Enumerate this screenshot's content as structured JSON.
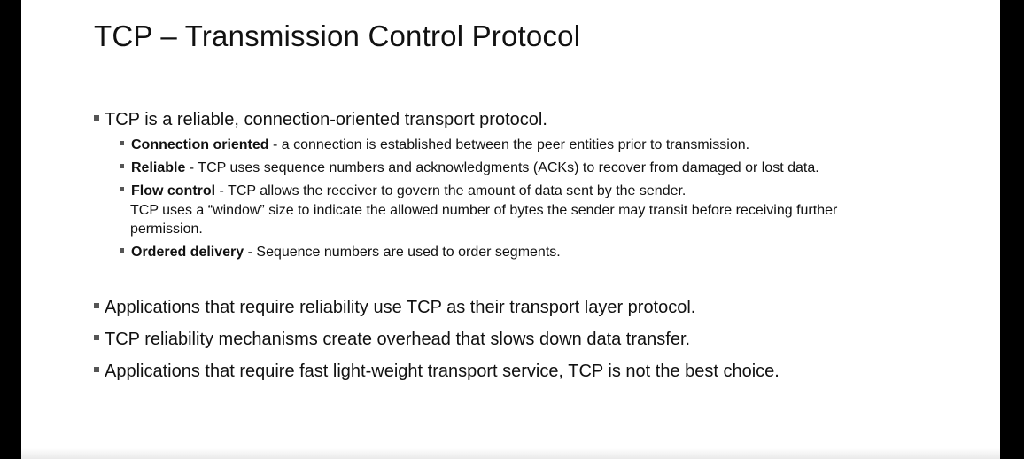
{
  "title": "TCP – Transmission Control Protocol",
  "main_bullet": "TCP is a reliable, connection-oriented transport protocol.",
  "sub_bullets": [
    {
      "term": "Connection oriented",
      "text": " - a connection is established between the peer entities prior to transmission."
    },
    {
      "term": "Reliable",
      "text": " - TCP uses sequence numbers and acknowledgments (ACKs) to recover from damaged or lost data."
    },
    {
      "term": "Flow control",
      "text": " - TCP allows the receiver to govern the amount of data sent by the sender.",
      "line2": "TCP uses a “window” size to indicate the allowed number of bytes the sender may transit before receiving further",
      "line3": "permission."
    },
    {
      "term": "Ordered delivery",
      "text": " - Sequence numbers are used to order segments."
    }
  ],
  "bottom_bullets": [
    "Applications that require reliability use TCP as their transport layer protocol.",
    "TCP reliability mechanisms create overhead that slows down data transfer.",
    "Applications that require fast light-weight transport service, TCP is not the best choice."
  ]
}
